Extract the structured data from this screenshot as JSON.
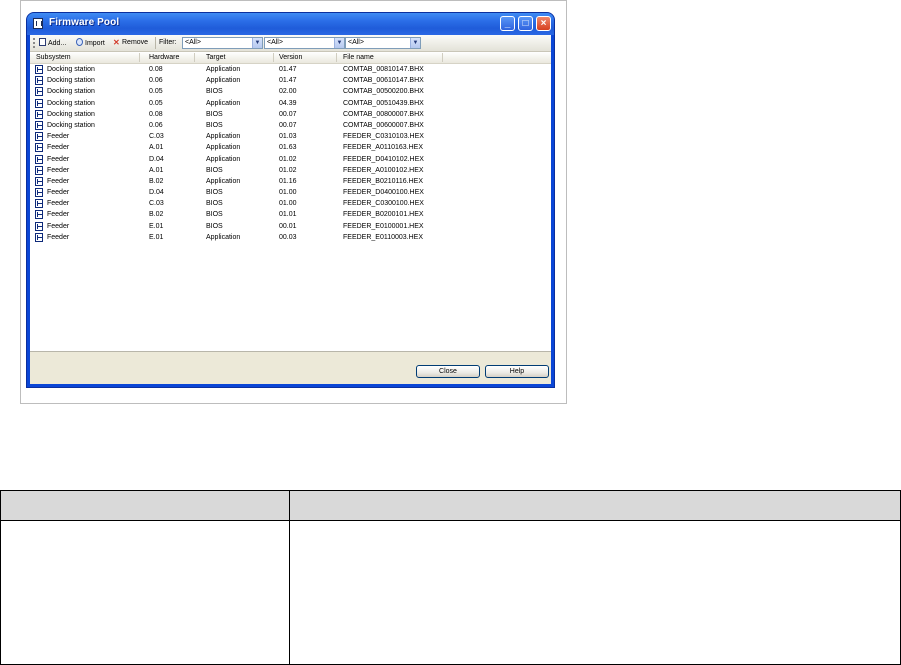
{
  "window": {
    "title": "Firmware Pool",
    "controls": {
      "minimize": "_",
      "maximize": "□",
      "close": "×"
    }
  },
  "toolbar": {
    "add_label": "Add...",
    "import_label": "Import",
    "remove_label": "Remove",
    "filter_label": "Filter:",
    "filters": [
      "<All>",
      "<All>",
      "<All>"
    ]
  },
  "list": {
    "columns": [
      "Subsystem",
      "Hardware",
      "Target",
      "Version",
      "File name"
    ],
    "rows": [
      {
        "subsystem": "Docking station",
        "hardware": "0.08",
        "target": "Application",
        "version": "01.47",
        "file": "COMTAB_00810147.BHX"
      },
      {
        "subsystem": "Docking station",
        "hardware": "0.06",
        "target": "Application",
        "version": "01.47",
        "file": "COMTAB_00610147.BHX"
      },
      {
        "subsystem": "Docking station",
        "hardware": "0.05",
        "target": "BIOS",
        "version": "02.00",
        "file": "COMTAB_00500200.BHX"
      },
      {
        "subsystem": "Docking station",
        "hardware": "0.05",
        "target": "Application",
        "version": "04.39",
        "file": "COMTAB_00510439.BHX"
      },
      {
        "subsystem": "Docking station",
        "hardware": "0.08",
        "target": "BIOS",
        "version": "00.07",
        "file": "COMTAB_00800007.BHX"
      },
      {
        "subsystem": "Docking station",
        "hardware": "0.06",
        "target": "BIOS",
        "version": "00.07",
        "file": "COMTAB_00600007.BHX"
      },
      {
        "subsystem": "Feeder",
        "hardware": "C.03",
        "target": "Application",
        "version": "01.03",
        "file": "FEEDER_C0310103.HEX"
      },
      {
        "subsystem": "Feeder",
        "hardware": "A.01",
        "target": "Application",
        "version": "01.63",
        "file": "FEEDER_A0110163.HEX"
      },
      {
        "subsystem": "Feeder",
        "hardware": "D.04",
        "target": "Application",
        "version": "01.02",
        "file": "FEEDER_D0410102.HEX"
      },
      {
        "subsystem": "Feeder",
        "hardware": "A.01",
        "target": "BIOS",
        "version": "01.02",
        "file": "FEEDER_A0100102.HEX"
      },
      {
        "subsystem": "Feeder",
        "hardware": "B.02",
        "target": "Application",
        "version": "01.16",
        "file": "FEEDER_B0210116.HEX"
      },
      {
        "subsystem": "Feeder",
        "hardware": "D.04",
        "target": "BIOS",
        "version": "01.00",
        "file": "FEEDER_D0400100.HEX"
      },
      {
        "subsystem": "Feeder",
        "hardware": "C.03",
        "target": "BIOS",
        "version": "01.00",
        "file": "FEEDER_C0300100.HEX"
      },
      {
        "subsystem": "Feeder",
        "hardware": "B.02",
        "target": "BIOS",
        "version": "01.01",
        "file": "FEEDER_B0200101.HEX"
      },
      {
        "subsystem": "Feeder",
        "hardware": "E.01",
        "target": "BIOS",
        "version": "00.01",
        "file": "FEEDER_E0100001.HEX"
      },
      {
        "subsystem": "Feeder",
        "hardware": "E.01",
        "target": "Application",
        "version": "00.03",
        "file": "FEEDER_E0110003.HEX"
      }
    ]
  },
  "buttons": {
    "close": "Close",
    "help": "Help"
  },
  "colors": {
    "titlebar": "#2b6ee8",
    "window_border": "#0a46d6",
    "dialog_bg": "#ece9d8",
    "close_button": "#d64020"
  }
}
